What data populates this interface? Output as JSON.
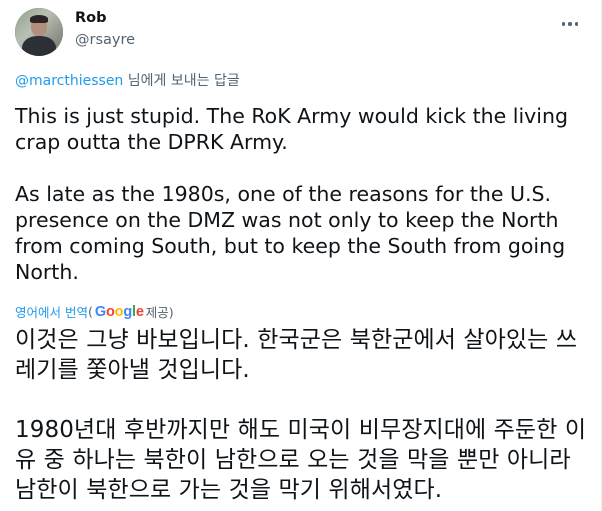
{
  "author": {
    "name": "Rob",
    "handle": "@rsayre"
  },
  "reply": {
    "handle": "@marcthiessen",
    "suffix": " 님에게 보내는 답글"
  },
  "tweet": {
    "paragraphs": [
      "This is just stupid. The RoK Army would kick the living crap outta the DPRK Army.",
      "As late as the 1980s, one of the reasons for the U.S. presence on the DMZ was not only to keep the North from coming South, but to keep the South from going North."
    ]
  },
  "translation": {
    "link_text": "영어에서 번역",
    "prefix": "(",
    "provider": "Google",
    "suffix": " 제공)",
    "paragraphs": [
      "이것은 그냥 바보입니다. 한국군은 북한군에서 살아있는 쓰레기를 쫓아낼 것입니다.",
      " 1980년대 후반까지만 해도 미국이 비무장지대에 주둔한 이유 중 하나는 북한이 남한으로 오는 것을 막을 뿐만 아니라 남한이 북한으로 가는 것을 막기 위해서였다."
    ]
  }
}
